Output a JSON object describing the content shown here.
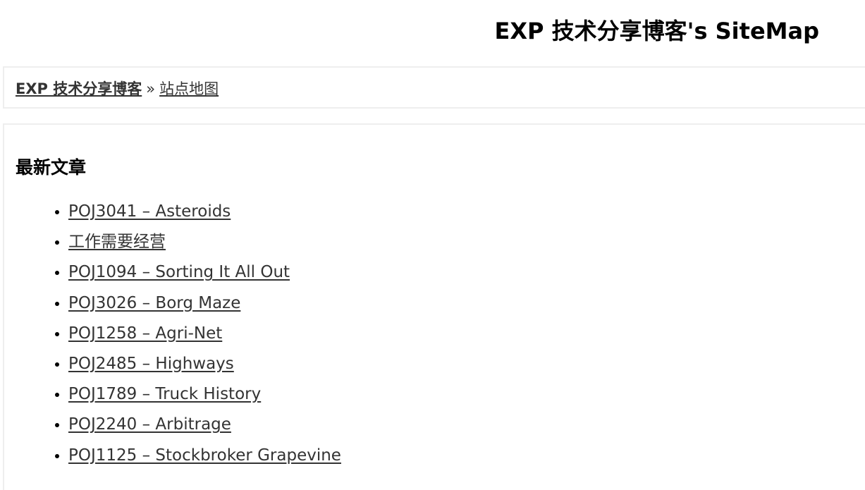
{
  "header": {
    "title": "EXP 技术分享博客's SiteMap"
  },
  "breadcrumb": {
    "home": "EXP 技术分享博客",
    "separator": "»",
    "current": "站点地图"
  },
  "recent_posts": {
    "heading": "最新文章",
    "items": [
      {
        "title": "POJ3041 – Asteroids"
      },
      {
        "title": "工作需要经营"
      },
      {
        "title": "POJ1094 – Sorting It All Out"
      },
      {
        "title": "POJ3026 – Borg Maze"
      },
      {
        "title": "POJ1258 – Agri-Net"
      },
      {
        "title": "POJ2485 – Highways"
      },
      {
        "title": "POJ1789 – Truck History"
      },
      {
        "title": "POJ2240 – Arbitrage"
      },
      {
        "title": "POJ1125 – Stockbroker Grapevine"
      }
    ]
  },
  "colors": {
    "link": "#333333",
    "border": "#eeeeee",
    "background": "#ffffff"
  }
}
